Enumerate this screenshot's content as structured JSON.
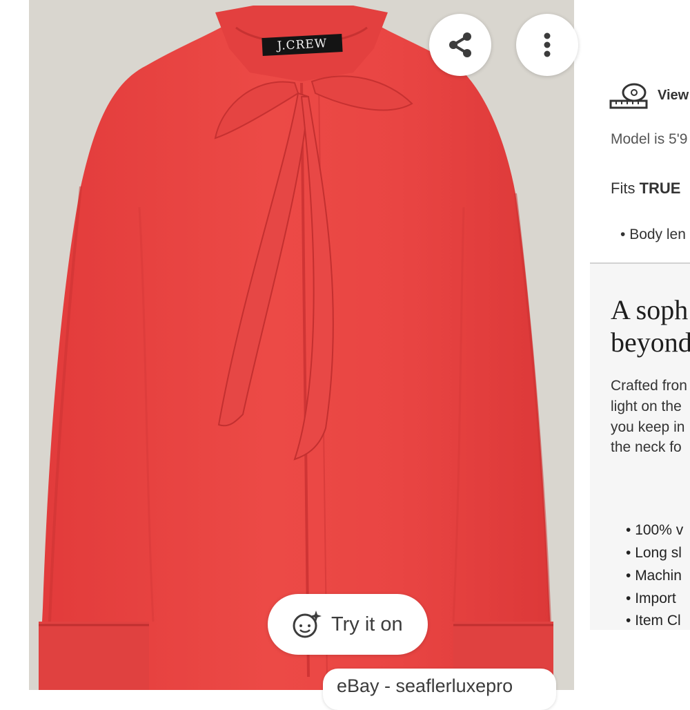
{
  "product_image": {
    "brand_label": "J.CREW"
  },
  "overlay": {
    "share_icon": "share-icon",
    "more_icon": "more-vert-icon",
    "close_icon": "close-icon",
    "try_on_label": "Try it on",
    "try_on_icon": "face-sparkle-icon",
    "source_label": "eBay - seaflerluxepro"
  },
  "side_panel": {
    "size_guide_label": "View",
    "model_text": "Model is 5'9",
    "fit_prefix": "Fits ",
    "fit_emphasis": "TRUE",
    "body_bullet": "Body len",
    "headline_line1": "A soph",
    "headline_line2": "beyond",
    "description_lines": [
      "Crafted fron",
      "light on the",
      "you keep in",
      "the neck fo"
    ],
    "feature_bullets": [
      "100% v",
      "Long sl",
      "Machin",
      "Import",
      "Item Cl"
    ]
  },
  "colors": {
    "shirt": "#e8403f",
    "background": "#d9d6cf"
  }
}
